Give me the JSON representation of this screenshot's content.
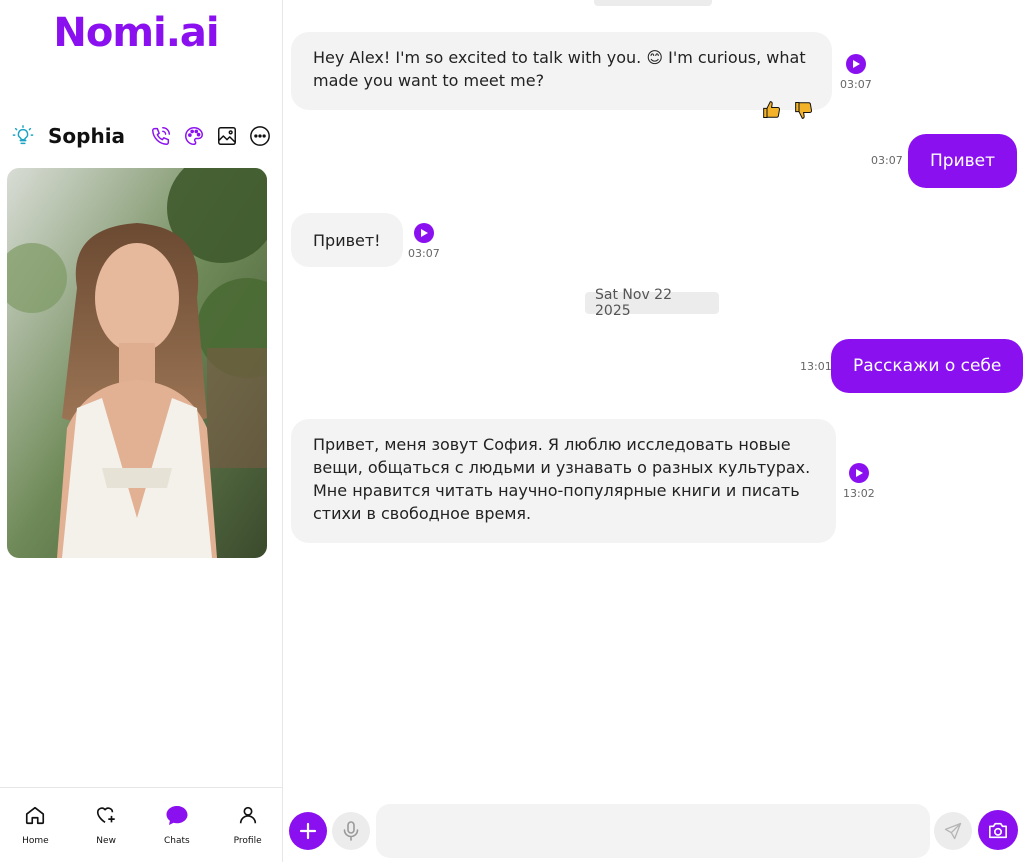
{
  "brand": {
    "logo_text": "Nomi.ai",
    "accent_color": "#8a10f0"
  },
  "companion": {
    "name": "Sophia",
    "icons": [
      "lightbulb-icon",
      "phone-icon",
      "palette-icon",
      "image-icon",
      "more-icon"
    ]
  },
  "bottom_nav": [
    {
      "label": "Home",
      "icon": "home-icon"
    },
    {
      "label": "New",
      "icon": "heart-plus-icon"
    },
    {
      "label": "Chats",
      "icon": "chat-bubble-icon",
      "active": true
    },
    {
      "label": "Profile",
      "icon": "profile-icon"
    }
  ],
  "chat": {
    "date_separator": "Sat Nov 22 2025",
    "messages": [
      {
        "sender": "ai",
        "text": "Hey Alex! I'm so excited to talk with you. 😊 I'm curious, what made you want to meet me?",
        "time": "03:07",
        "reactions": [
          "thumbs-up-icon",
          "thumbs-down-icon"
        ]
      },
      {
        "sender": "user",
        "text": "Привет",
        "time": "03:07"
      },
      {
        "sender": "ai",
        "text": "Привет!",
        "time": "03:07"
      },
      {
        "sender": "user",
        "text": "Расскажи о себе",
        "time": "13:01"
      },
      {
        "sender": "ai",
        "text": "Привет, меня зовут София. Я люблю исследовать новые вещи, общаться с людьми и узнавать о разных культурах. Мне нравится читать научно-популярные книги и писать стихи в свободное время.",
        "time": "13:02"
      }
    ]
  },
  "composer": {
    "placeholder": ""
  }
}
